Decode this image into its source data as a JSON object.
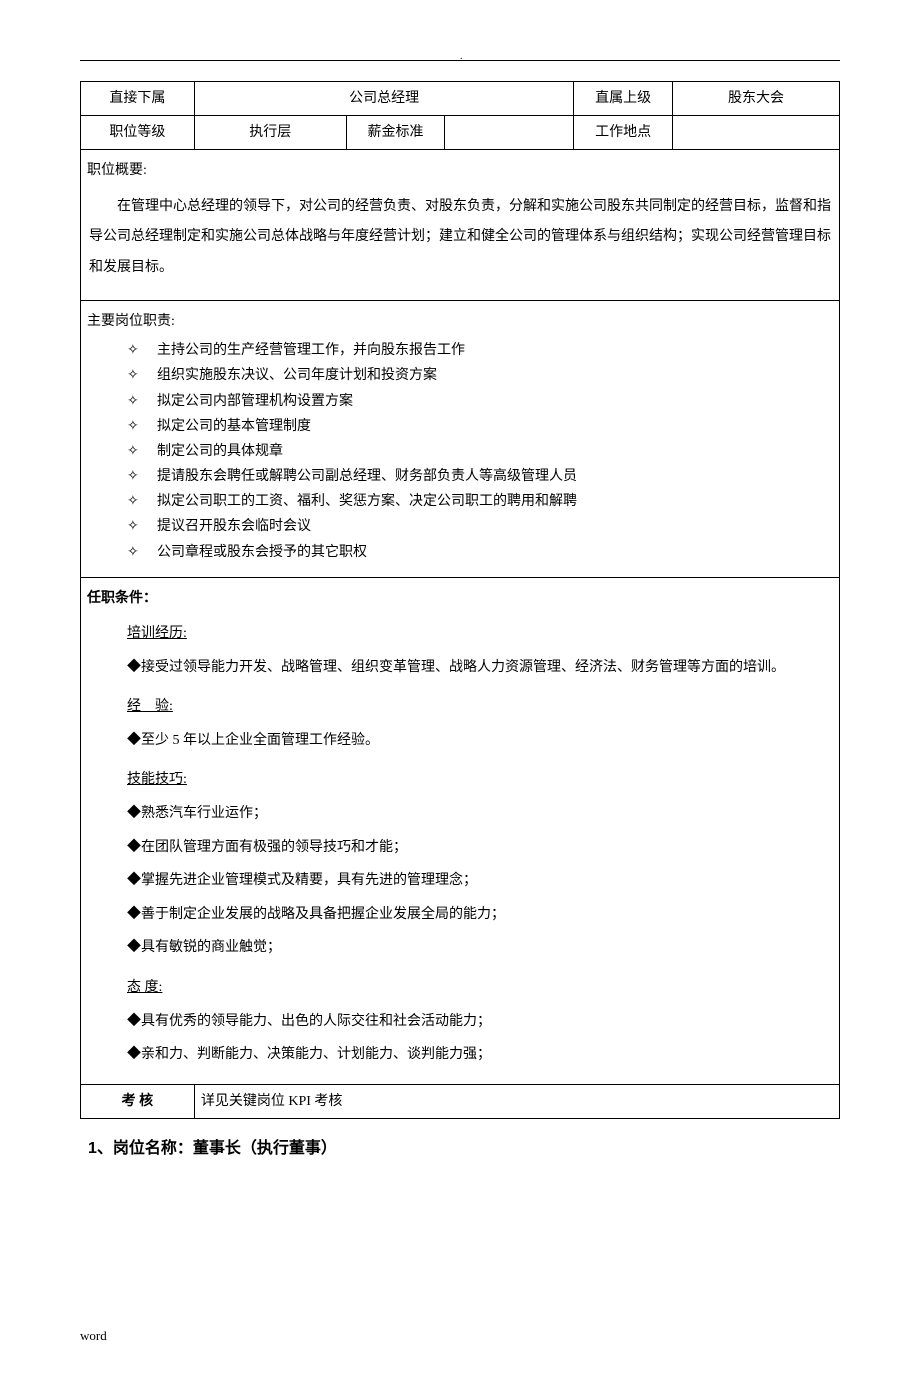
{
  "header_rows": {
    "row1": {
      "label1": "直接下属",
      "value1": "公司总经理",
      "label2": "直属上级",
      "value2": "股东大会"
    },
    "row2": {
      "label1": "职位等级",
      "value1": "执行层",
      "label2": "薪金标准",
      "value2": "",
      "label3": "工作地点",
      "value3": ""
    }
  },
  "overview": {
    "title": "职位概要:",
    "text": "在管理中心总经理的领导下，对公司的经营负责、对股东负责，分解和实施公司股东共同制定的经营目标，监督和指导公司总经理制定和实施公司总体战略与年度经营计划；建立和健全公司的管理体系与组织结构；实现公司经营管理目标和发展目标。"
  },
  "duties": {
    "title": "主要岗位职责:",
    "items": [
      "主持公司的生产经营管理工作，并向股东报告工作",
      "组织实施股东决议、公司年度计划和投资方案",
      "拟定公司内部管理机构设置方案",
      "拟定公司的基本管理制度",
      "制定公司的具体规章",
      "提请股东会聘任或解聘公司副总经理、财务部负责人等高级管理人员",
      "拟定公司职工的工资、福利、奖惩方案、决定公司职工的聘用和解聘",
      "提议召开股东会临时会议",
      "公司章程或股东会授予的其它职权"
    ]
  },
  "qualifications": {
    "title": "任职条件：",
    "sections": [
      {
        "heading": "培训经历:",
        "items": [
          "接受过领导能力开发、战略管理、组织变革管理、战略人力资源管理、经济法、财务管理等方面的培训。"
        ]
      },
      {
        "heading": "经　验:",
        "items": [
          "至少 5 年以上企业全面管理工作经验。"
        ]
      },
      {
        "heading": "技能技巧:",
        "items": [
          "熟悉汽车行业运作；",
          "在团队管理方面有极强的领导技巧和才能；",
          "掌握先进企业管理模式及精要，具有先进的管理理念；",
          "善于制定企业发展的战略及具备把握企业发展全局的能力；",
          "具有敏锐的商业触觉；"
        ]
      },
      {
        "heading": "态 度:",
        "items": [
          "具有优秀的领导能力、出色的人际交往和社会活动能力；",
          "亲和力、判断能力、决策能力、计划能力、谈判能力强；"
        ]
      }
    ]
  },
  "assessment": {
    "label": "考 核",
    "value": "详见关键岗位 KPI 考核"
  },
  "bottom_heading": "1、岗位名称：董事长（执行董事）",
  "footer": "word"
}
